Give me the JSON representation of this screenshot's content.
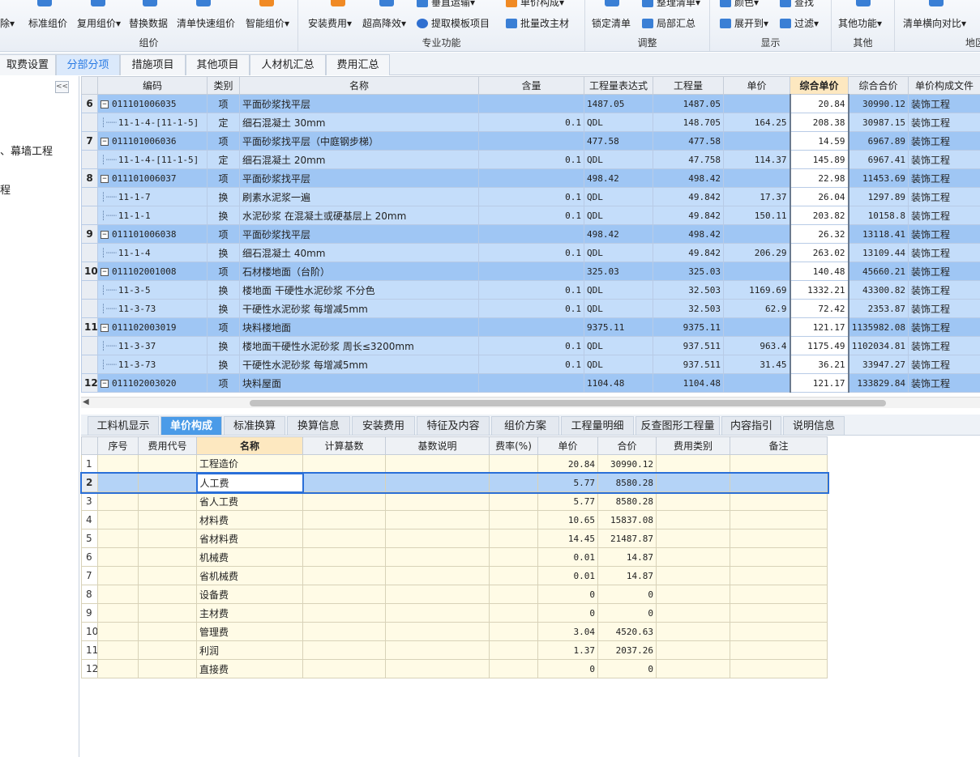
{
  "ribbon": {
    "groups": [
      {
        "title": "组价",
        "buttons": [
          "除▾",
          "标准组价",
          "复用组价▾",
          "替换数据",
          "清单快速组价",
          "智能组价▾"
        ]
      },
      {
        "title": "专业功能",
        "buttons": [
          "安装费用▾",
          "超高降效▾",
          "提取模板项目",
          "垂直运输▾",
          "单价构成▾",
          "批量改主材"
        ]
      },
      {
        "title": "调整",
        "buttons": [
          "锁定清单",
          "整理清单▾",
          "局部汇总"
        ]
      },
      {
        "title": "显示",
        "buttons": [
          "颜色▾",
          "查找",
          "展开到▾",
          "过滤▾"
        ]
      },
      {
        "title": "其他",
        "buttons": [
          "其他功能▾"
        ]
      },
      {
        "title": "地区",
        "buttons": [
          "清单横向对比▾"
        ]
      }
    ]
  },
  "tabs": [
    "取费设置",
    "分部分项",
    "措施项目",
    "其他项目",
    "人材机汇总",
    "费用汇总"
  ],
  "active_tab": "分部分项",
  "left_panel": {
    "collapse": "<<",
    "items": [
      "、幕墙工程",
      "程"
    ]
  },
  "upper_grid": {
    "headers": [
      "编码",
      "类别",
      "名称",
      "含量",
      "工程量表达式",
      "工程量",
      "单价",
      "综合单价",
      "综合合价",
      "单价构成文件"
    ],
    "rows": [
      {
        "no": "6",
        "type": "item",
        "code": "011101006035",
        "cat": "项",
        "name": "平面砂浆找平层",
        "qty": "",
        "expr": "1487.05",
        "amount": "1487.05",
        "price": "",
        "unit": "20.84",
        "total": "30990.12",
        "file": "装饰工程"
      },
      {
        "no": "",
        "type": "sub",
        "code": "11-1-4-[11-1-5]",
        "cat": "定",
        "name": "细石混凝土 30mm",
        "qty": "0.1",
        "expr": "QDL",
        "amount": "148.705",
        "price": "164.25",
        "unit": "208.38",
        "total": "30987.15",
        "file": "装饰工程"
      },
      {
        "no": "7",
        "type": "item",
        "code": "011101006036",
        "cat": "项",
        "name": "平面砂浆找平层（中庭钢步梯）",
        "qty": "",
        "expr": "477.58",
        "amount": "477.58",
        "price": "",
        "unit": "14.59",
        "total": "6967.89",
        "file": "装饰工程"
      },
      {
        "no": "",
        "type": "sub",
        "code": "11-1-4-[11-1-5]",
        "cat": "定",
        "name": "细石混凝土 20mm",
        "qty": "0.1",
        "expr": "QDL",
        "amount": "47.758",
        "price": "114.37",
        "unit": "145.89",
        "total": "6967.41",
        "file": "装饰工程"
      },
      {
        "no": "8",
        "type": "item",
        "code": "011101006037",
        "cat": "项",
        "name": "平面砂浆找平层",
        "qty": "",
        "expr": "498.42",
        "amount": "498.42",
        "price": "",
        "unit": "22.98",
        "total": "11453.69",
        "file": "装饰工程"
      },
      {
        "no": "",
        "type": "sub",
        "code": "11-1-7",
        "cat": "换",
        "name": "刷素水泥浆一遍",
        "qty": "0.1",
        "expr": "QDL",
        "amount": "49.842",
        "price": "17.37",
        "unit": "26.04",
        "total": "1297.89",
        "file": "装饰工程"
      },
      {
        "no": "",
        "type": "sub",
        "code": "11-1-1",
        "cat": "换",
        "name": "水泥砂浆 在混凝土或硬基层上 20mm",
        "qty": "0.1",
        "expr": "QDL",
        "amount": "49.842",
        "price": "150.11",
        "unit": "203.82",
        "total": "10158.8",
        "file": "装饰工程"
      },
      {
        "no": "9",
        "type": "item",
        "code": "011101006038",
        "cat": "项",
        "name": "平面砂浆找平层",
        "qty": "",
        "expr": "498.42",
        "amount": "498.42",
        "price": "",
        "unit": "26.32",
        "total": "13118.41",
        "file": "装饰工程"
      },
      {
        "no": "",
        "type": "sub",
        "code": "11-1-4",
        "cat": "换",
        "name": "细石混凝土 40mm",
        "qty": "0.1",
        "expr": "QDL",
        "amount": "49.842",
        "price": "206.29",
        "unit": "263.02",
        "total": "13109.44",
        "file": "装饰工程"
      },
      {
        "no": "10",
        "type": "item",
        "code": "011102001008",
        "cat": "项",
        "name": "石材楼地面（台阶）",
        "qty": "",
        "expr": "325.03",
        "amount": "325.03",
        "price": "",
        "unit": "140.48",
        "total": "45660.21",
        "file": "装饰工程"
      },
      {
        "no": "",
        "type": "sub",
        "code": "11-3-5",
        "cat": "换",
        "name": "楼地面 干硬性水泥砂浆 不分色",
        "qty": "0.1",
        "expr": "QDL",
        "amount": "32.503",
        "price": "1169.69",
        "unit": "1332.21",
        "total": "43300.82",
        "file": "装饰工程"
      },
      {
        "no": "",
        "type": "sub",
        "code": "11-3-73",
        "cat": "换",
        "name": "干硬性水泥砂浆 每增减5mm",
        "qty": "0.1",
        "expr": "QDL",
        "amount": "32.503",
        "price": "62.9",
        "unit": "72.42",
        "total": "2353.87",
        "file": "装饰工程"
      },
      {
        "no": "11",
        "type": "item",
        "code": "011102003019",
        "cat": "项",
        "name": "块料楼地面",
        "qty": "",
        "expr": "9375.11",
        "amount": "9375.11",
        "price": "",
        "unit": "121.17",
        "total": "1135982.08",
        "file": "装饰工程"
      },
      {
        "no": "",
        "type": "sub",
        "code": "11-3-37",
        "cat": "换",
        "name": "楼地面干硬性水泥砂浆 周长≤3200mm",
        "qty": "0.1",
        "expr": "QDL",
        "amount": "937.511",
        "price": "963.4",
        "unit": "1175.49",
        "total": "1102034.81",
        "file": "装饰工程"
      },
      {
        "no": "",
        "type": "sub",
        "code": "11-3-73",
        "cat": "换",
        "name": "干硬性水泥砂浆 每增减5mm",
        "qty": "0.1",
        "expr": "QDL",
        "amount": "937.511",
        "price": "31.45",
        "unit": "36.21",
        "total": "33947.27",
        "file": "装饰工程"
      },
      {
        "no": "12",
        "type": "item",
        "code": "011102003020",
        "cat": "项",
        "name": "块料屋面",
        "qty": "",
        "expr": "1104.48",
        "amount": "1104.48",
        "price": "",
        "unit": "121.17",
        "total": "133829.84",
        "file": "装饰工程"
      }
    ]
  },
  "bottom_tabs": [
    "工料机显示",
    "单价构成",
    "标准换算",
    "换算信息",
    "安装费用",
    "特征及内容",
    "组价方案",
    "工程量明细",
    "反查图形工程量",
    "内容指引",
    "说明信息"
  ],
  "bottom_active": "单价构成",
  "lower_grid": {
    "headers": [
      "",
      "序号",
      "费用代号",
      "名称",
      "计算基数",
      "基数说明",
      "费率(%)",
      "单价",
      "合价",
      "费用类别",
      "备注"
    ],
    "rows": [
      {
        "rn": "1",
        "name": "工程造价",
        "price": "20.84",
        "total": "30990.12"
      },
      {
        "rn": "2",
        "name": "人工费",
        "price": "5.77",
        "total": "8580.28"
      },
      {
        "rn": "3",
        "name": "省人工费",
        "price": "5.77",
        "total": "8580.28"
      },
      {
        "rn": "4",
        "name": "材料费",
        "price": "10.65",
        "total": "15837.08"
      },
      {
        "rn": "5",
        "name": "省材料费",
        "price": "14.45",
        "total": "21487.87"
      },
      {
        "rn": "6",
        "name": "机械费",
        "price": "0.01",
        "total": "14.87"
      },
      {
        "rn": "7",
        "name": "省机械费",
        "price": "0.01",
        "total": "14.87"
      },
      {
        "rn": "8",
        "name": "设备费",
        "price": "0",
        "total": "0"
      },
      {
        "rn": "9",
        "name": "主材费",
        "price": "0",
        "total": "0"
      },
      {
        "rn": "10",
        "name": "管理费",
        "price": "3.04",
        "total": "4520.63"
      },
      {
        "rn": "11",
        "name": "利润",
        "price": "1.37",
        "total": "2037.26"
      },
      {
        "rn": "12",
        "name": "直接费",
        "price": "0",
        "total": "0"
      }
    ]
  },
  "colors": {
    "accent": "#2a7be4",
    "item_row": "#9fc6f4",
    "sub_row": "#c4ddfa",
    "lower_row": "#fffbe6"
  }
}
